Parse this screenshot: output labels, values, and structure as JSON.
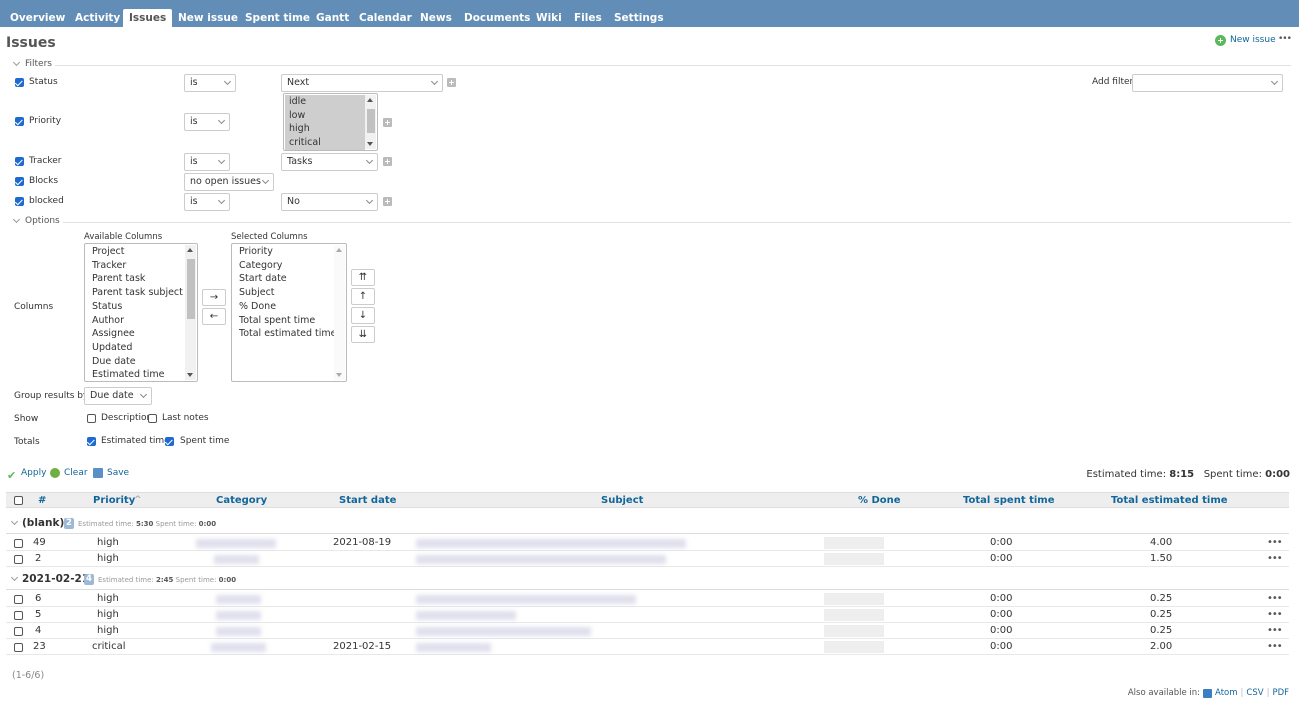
{
  "nav": {
    "tabs": [
      {
        "label": "Overview",
        "active": false
      },
      {
        "label": "Activity",
        "active": false
      },
      {
        "label": "Issues",
        "active": true
      },
      {
        "label": "New issue",
        "active": false
      },
      {
        "label": "Spent time",
        "active": false
      },
      {
        "label": "Gantt",
        "active": false
      },
      {
        "label": "Calendar",
        "active": false
      },
      {
        "label": "News",
        "active": false
      },
      {
        "label": "Documents",
        "active": false
      },
      {
        "label": "Wiki",
        "active": false
      },
      {
        "label": "Files",
        "active": false
      },
      {
        "label": "Settings",
        "active": false
      }
    ]
  },
  "page": {
    "title": "Issues",
    "new_issue_label": "New issue",
    "more_label": "•••"
  },
  "filters": {
    "legend": "Filters",
    "add_filter_label": "Add filter",
    "add_filter_value": "",
    "rows": [
      {
        "name": "Status",
        "checked": true,
        "operator": "is",
        "value": "Next"
      },
      {
        "name": "Priority",
        "checked": true,
        "operator": "is",
        "values": [
          "idle",
          "low",
          "high",
          "critical"
        ]
      },
      {
        "name": "Tracker",
        "checked": true,
        "operator": "is",
        "value": "Tasks"
      },
      {
        "name": "Blocks",
        "checked": true,
        "operator": "no open issues"
      },
      {
        "name": "blocked",
        "checked": true,
        "operator": "is",
        "value": "No"
      }
    ]
  },
  "options": {
    "legend": "Options",
    "columns_label": "Columns",
    "available_label": "Available Columns",
    "selected_label": "Selected Columns",
    "available": [
      "Project",
      "Tracker",
      "Parent task",
      "Parent task subject",
      "Status",
      "Author",
      "Assignee",
      "Updated",
      "Due date",
      "Estimated time"
    ],
    "selected": [
      "Priority",
      "Category",
      "Start date",
      "Subject",
      "% Done",
      "Total spent time",
      "Total estimated time"
    ],
    "move_right": "→",
    "move_left": "←",
    "move_top": "⇈",
    "move_up": "↑",
    "move_down": "↓",
    "move_bottom": "⇊",
    "group_by_label": "Group results by",
    "group_by_value": "Due date",
    "show_label": "Show",
    "show_description": "Description",
    "show_last_notes": "Last notes",
    "totals_label": "Totals",
    "totals_estimated": "Estimated time",
    "totals_spent": "Spent time"
  },
  "actions": {
    "apply": "Apply",
    "clear": "Clear",
    "save": "Save"
  },
  "totals": {
    "estimated_label": "Estimated time:",
    "estimated_value": "8:15",
    "spent_label": "Spent time:",
    "spent_value": "0:00"
  },
  "table": {
    "headers": {
      "id": "#",
      "priority": "Priority",
      "sort_indicator": "^",
      "category": "Category",
      "start_date": "Start date",
      "subject": "Subject",
      "done": "% Done",
      "total_spent": "Total spent time",
      "total_estimated": "Total estimated time"
    },
    "groups": [
      {
        "name": "(blank)",
        "count": "2",
        "est_label": "Estimated time:",
        "est_value": "5:30",
        "spent_label": "Spent time:",
        "spent_value": "0:00",
        "rows": [
          {
            "id": "49",
            "priority": "high",
            "start_date": "2021-08-19",
            "done": 0,
            "spent": "0:00",
            "estimated": "4.00"
          },
          {
            "id": "2",
            "priority": "high",
            "start_date": "",
            "done": 0,
            "spent": "0:00",
            "estimated": "1.50"
          }
        ]
      },
      {
        "name": "2021-02-21",
        "count": "4",
        "est_label": "Estimated time:",
        "est_value": "2:45",
        "spent_label": "Spent time:",
        "spent_value": "0:00",
        "rows": [
          {
            "id": "6",
            "priority": "high",
            "start_date": "",
            "done": 0,
            "spent": "0:00",
            "estimated": "0.25"
          },
          {
            "id": "5",
            "priority": "high",
            "start_date": "",
            "done": 0,
            "spent": "0:00",
            "estimated": "0.25"
          },
          {
            "id": "4",
            "priority": "high",
            "start_date": "",
            "done": 0,
            "spent": "0:00",
            "estimated": "0.25"
          },
          {
            "id": "23",
            "priority": "critical",
            "start_date": "2021-02-15",
            "done": 0,
            "spent": "0:00",
            "estimated": "2.00"
          }
        ]
      }
    ],
    "row_menu": "•••"
  },
  "footer": {
    "pagination": "(1-6/6)",
    "also_available": "Also available in:",
    "atom": "Atom",
    "sep1": "|",
    "csv": "CSV",
    "sep2": "|",
    "pdf": "PDF"
  }
}
